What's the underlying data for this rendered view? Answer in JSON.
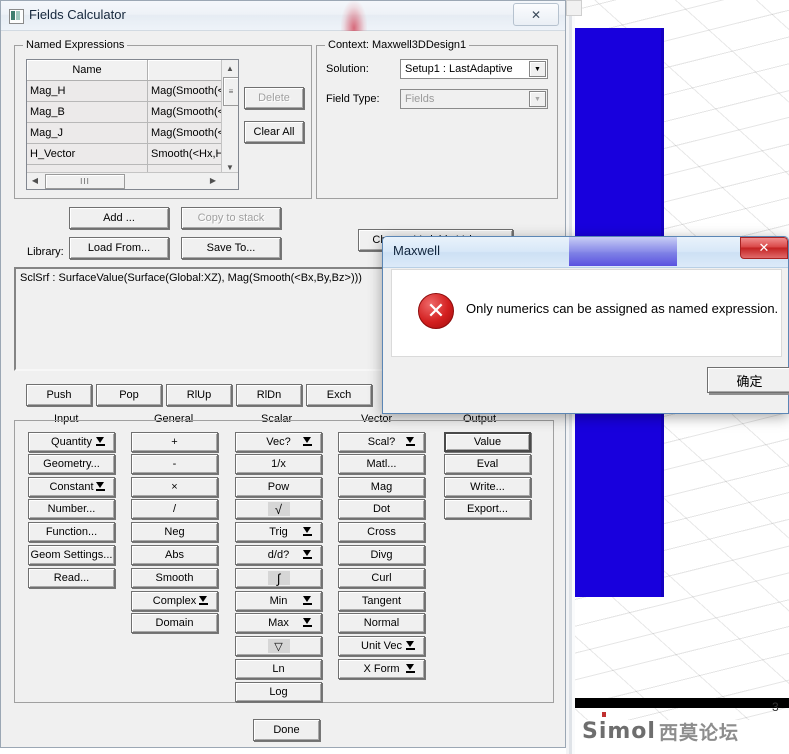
{
  "window": {
    "title": "Fields Calculator",
    "icon": "app-icon",
    "close_label": "✕"
  },
  "named_expressions": {
    "group_label": "Named Expressions",
    "columns": [
      "Name",
      ""
    ],
    "rows": [
      {
        "name": "Mag_H",
        "expr": "Mag(Smooth(<H"
      },
      {
        "name": "Mag_B",
        "expr": "Mag(Smooth(<B"
      },
      {
        "name": "Mag_J",
        "expr": "Mag(Smooth(<J"
      },
      {
        "name": "H_Vector",
        "expr": "Smooth(<Hx,Hy"
      },
      {
        "name": "",
        "expr": ""
      }
    ],
    "delete_label": "Delete",
    "clear_all_label": "Clear All",
    "scroll_up": "▲",
    "scroll_down": "▼",
    "scroll_left": "◀",
    "scroll_right": "▶",
    "thumb_grip": "≡",
    "h_thumb_grip": "III"
  },
  "context": {
    "group_label": "Context: Maxwell3DDesign1",
    "solution_label": "Solution:",
    "solution_value": "Setup1 : LastAdaptive",
    "field_type_label": "Field Type:",
    "field_type_value": "Fields",
    "dropdown_glyph": "▼"
  },
  "library": {
    "add_label": "Add ...",
    "copy_to_stack_label": "Copy to stack",
    "library_label": "Library:",
    "load_from_label": "Load From...",
    "save_to_label": "Save To...",
    "change_variable_values_label": "Change Variable Values..."
  },
  "expression": {
    "text": "SclSrf : SurfaceValue(Surface(Global:XZ), Mag(Smooth(<Bx,By,Bz>)))"
  },
  "stack_buttons": [
    "Push",
    "Pop",
    "RlUp",
    "RlDn",
    "Exch"
  ],
  "columns": [
    {
      "header": "Input",
      "buttons": [
        {
          "label": "Quantity",
          "arrow": true
        },
        {
          "label": "Geometry...",
          "arrow": false
        },
        {
          "label": "Constant",
          "arrow": true
        },
        {
          "label": "Number...",
          "arrow": false
        },
        {
          "label": "Function...",
          "arrow": false
        },
        {
          "label": "Geom Settings...",
          "arrow": false
        },
        {
          "label": "Read...",
          "arrow": false
        }
      ]
    },
    {
      "header": "General",
      "buttons": [
        {
          "label": "+",
          "arrow": false
        },
        {
          "label": "-",
          "arrow": false
        },
        {
          "label": "×",
          "arrow": false
        },
        {
          "label": "/",
          "arrow": false
        },
        {
          "label": "Neg",
          "arrow": false
        },
        {
          "label": "Abs",
          "arrow": false
        },
        {
          "label": "Smooth",
          "arrow": false
        },
        {
          "label": "Complex",
          "arrow": true
        },
        {
          "label": "Domain",
          "arrow": false
        }
      ]
    },
    {
      "header": "Scalar",
      "buttons": [
        {
          "label": "Vec?",
          "arrow": true
        },
        {
          "label": "1/x",
          "arrow": false
        },
        {
          "label": "Pow",
          "arrow": false
        },
        {
          "label": "√",
          "arrow": false,
          "glyph": true
        },
        {
          "label": "Trig",
          "arrow": true
        },
        {
          "label": "d/d?",
          "arrow": true
        },
        {
          "label": "∫",
          "arrow": false,
          "glyph": true
        },
        {
          "label": "Min",
          "arrow": true
        },
        {
          "label": "Max",
          "arrow": true
        },
        {
          "label": "▽",
          "arrow": false,
          "glyph": true
        },
        {
          "label": "Ln",
          "arrow": false
        },
        {
          "label": "Log",
          "arrow": false
        }
      ]
    },
    {
      "header": "Vector",
      "buttons": [
        {
          "label": "Scal?",
          "arrow": true
        },
        {
          "label": "Matl...",
          "arrow": false
        },
        {
          "label": "Mag",
          "arrow": false
        },
        {
          "label": "Dot",
          "arrow": false
        },
        {
          "label": "Cross",
          "arrow": false
        },
        {
          "label": "Divg",
          "arrow": false
        },
        {
          "label": "Curl",
          "arrow": false
        },
        {
          "label": "Tangent",
          "arrow": false
        },
        {
          "label": "Normal",
          "arrow": false
        },
        {
          "label": "Unit Vec",
          "arrow": true
        },
        {
          "label": "X Form",
          "arrow": true
        }
      ]
    },
    {
      "header": "Output",
      "buttons": [
        {
          "label": "Value",
          "arrow": false,
          "default": true
        },
        {
          "label": "Eval",
          "arrow": false
        },
        {
          "label": "Write...",
          "arrow": false
        },
        {
          "label": "Export...",
          "arrow": false
        }
      ]
    }
  ],
  "done_label": "Done",
  "dialog": {
    "title": "Maxwell",
    "message": "Only numerics can be assigned as named expression.",
    "ok_label": "确定",
    "close_label": "✕",
    "error_glyph": "✕"
  },
  "viewport": {
    "page_number": "3",
    "watermark_latin": "Simol",
    "watermark_cn": "西莫论坛"
  },
  "colors": {
    "solid_blue": "#1800dd",
    "error_red": "#c32222",
    "window_face": "#f0f0f0"
  }
}
